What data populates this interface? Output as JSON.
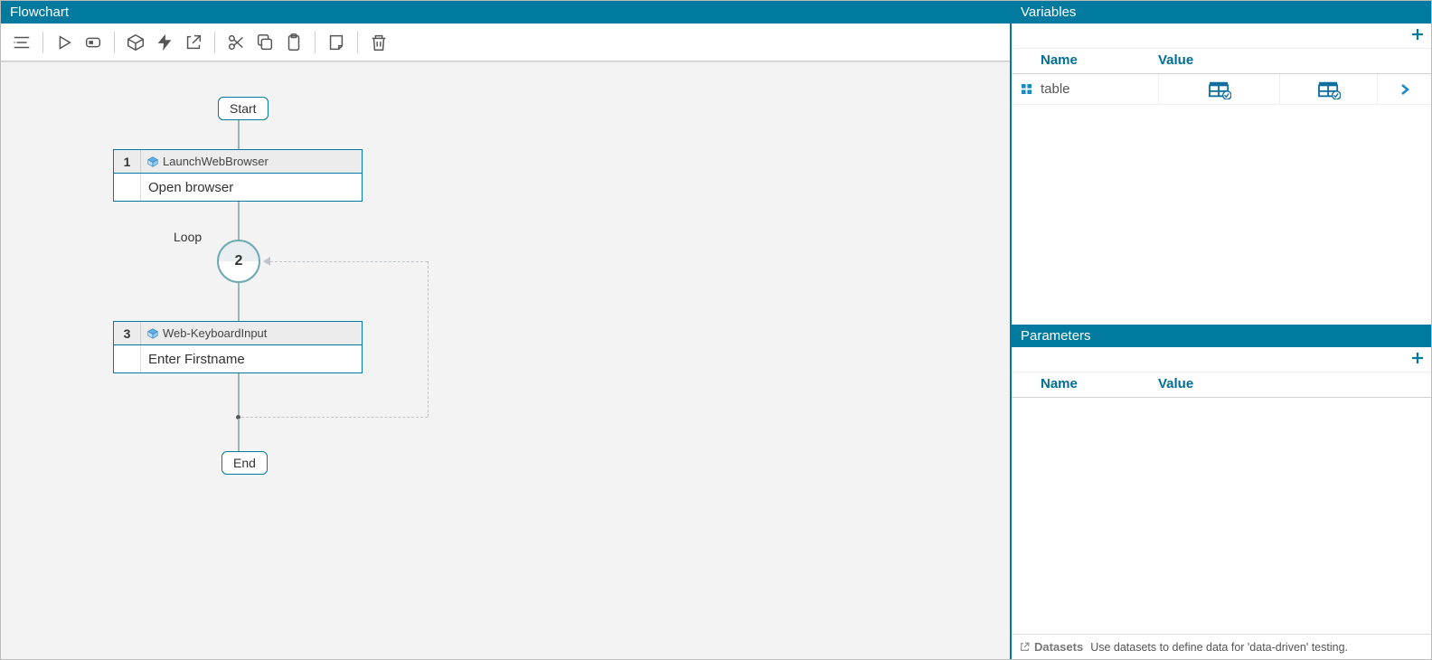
{
  "flowchart": {
    "title": "Flowchart",
    "start_label": "Start",
    "end_label": "End",
    "loop_label": "Loop",
    "loop_number": "2",
    "steps": [
      {
        "num": "1",
        "type": "LaunchWebBrowser",
        "body": "Open browser"
      },
      {
        "num": "3",
        "type": "Web-KeyboardInput",
        "body": "Enter Firstname"
      }
    ]
  },
  "variables": {
    "title": "Variables",
    "columns": {
      "name": "Name",
      "value": "Value"
    },
    "rows": [
      {
        "name": "table"
      }
    ]
  },
  "parameters": {
    "title": "Parameters",
    "columns": {
      "name": "Name",
      "value": "Value"
    }
  },
  "footer": {
    "datasets_label": "Datasets",
    "hint": "Use datasets to define data for 'data-driven' testing."
  }
}
